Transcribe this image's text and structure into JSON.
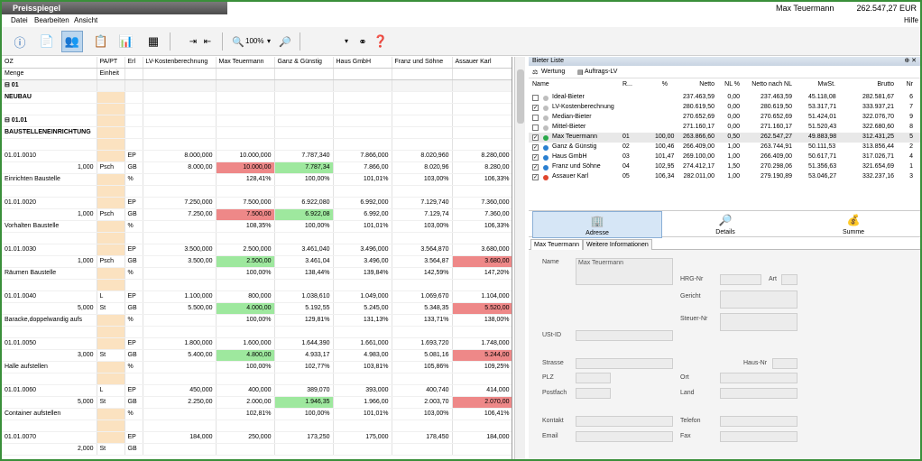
{
  "title": "Preisspiegel",
  "user": "Max Teuermann",
  "total": "262.547,27 EUR",
  "menu": {
    "datei": "Datei",
    "bearbeiten": "Bearbeiten",
    "ansicht": "Ansicht",
    "hilfe": "Hilfe"
  },
  "toolbar": {
    "zoom": "100%"
  },
  "grid": {
    "headers": [
      "OZ",
      "PA/PT",
      "Erl",
      "LV-Kostenberechnung",
      "Max Teuermann",
      "Ganz & Günstig",
      "Haus GmbH",
      "Franz und Söhne",
      "Assauer Karl"
    ],
    "subheaders": [
      "Menge",
      "Einheit"
    ],
    "rows": [
      {
        "c": [
          "⊟ 01",
          "",
          "",
          "",
          "",
          "",
          "",
          "",
          ""
        ],
        "t": "sec"
      },
      {
        "c": [
          "NEUBAU",
          "",
          "",
          "",
          "",
          "",
          "",
          "",
          ""
        ],
        "t": "bold"
      },
      {
        "c": [
          "",
          "",
          "",
          "",
          "",
          "",
          "",
          "",
          ""
        ]
      },
      {
        "c": [
          "⊟ 01.01",
          "",
          "",
          "",
          "",
          "",
          "",
          "",
          ""
        ],
        "t": "bold"
      },
      {
        "c": [
          "BAUSTELLENEINRICHTUNG",
          "",
          "",
          "",
          "",
          "",
          "",
          "",
          ""
        ],
        "t": "bold"
      },
      {
        "c": [
          "",
          "",
          "",
          "",
          "",
          "",
          "",
          "",
          ""
        ]
      },
      {
        "c": [
          "01.01.0010",
          "",
          "EP",
          "8.000,000",
          "10.000,000",
          "7.787,340",
          "7.866,000",
          "8.020,960",
          "8.280,000"
        ]
      },
      {
        "c": [
          "1,000",
          "Psch",
          "GB",
          "8.000,00",
          "10.000,00",
          "7.787,34",
          "7.866,00",
          "8.020,96",
          "8.280,00"
        ],
        "h": {
          "4": "red",
          "5": "green"
        }
      },
      {
        "c": [
          "Einrichten Baustelle",
          "",
          "%",
          "",
          "128,41%",
          "100,00%",
          "101,01%",
          "103,00%",
          "106,33%"
        ]
      },
      {
        "c": [
          "",
          "",
          "",
          "",
          "",
          "",
          "",
          "",
          ""
        ]
      },
      {
        "c": [
          "01.01.0020",
          "",
          "EP",
          "7.250,000",
          "7.500,000",
          "6.922,080",
          "6.992,000",
          "7.129,740",
          "7.360,000"
        ]
      },
      {
        "c": [
          "1,000",
          "Psch",
          "GB",
          "7.250,00",
          "7.500,00",
          "6.922,08",
          "6.992,00",
          "7.129,74",
          "7.360,00"
        ],
        "h": {
          "4": "red",
          "5": "green"
        }
      },
      {
        "c": [
          "Vorhalten Baustelle",
          "",
          "%",
          "",
          "108,35%",
          "100,00%",
          "101,01%",
          "103,00%",
          "106,33%"
        ]
      },
      {
        "c": [
          "",
          "",
          "",
          "",
          "",
          "",
          "",
          "",
          ""
        ]
      },
      {
        "c": [
          "01.01.0030",
          "",
          "EP",
          "3.500,000",
          "2.500,000",
          "3.461,040",
          "3.496,000",
          "3.564,870",
          "3.680,000"
        ]
      },
      {
        "c": [
          "1,000",
          "Psch",
          "GB",
          "3.500,00",
          "2.500,00",
          "3.461,04",
          "3.496,00",
          "3.564,87",
          "3.680,00"
        ],
        "h": {
          "4": "green",
          "8": "red"
        }
      },
      {
        "c": [
          "Räumen Baustelle",
          "",
          "%",
          "",
          "100,00%",
          "138,44%",
          "139,84%",
          "142,59%",
          "147,20%"
        ]
      },
      {
        "c": [
          "",
          "",
          "",
          "",
          "",
          "",
          "",
          "",
          ""
        ]
      },
      {
        "c": [
          "01.01.0040",
          "L",
          "EP",
          "1.100,000",
          "800,000",
          "1.038,610",
          "1.049,000",
          "1.069,670",
          "1.104,000"
        ]
      },
      {
        "c": [
          "5,000",
          "St",
          "GB",
          "5.500,00",
          "4.000,00",
          "5.192,55",
          "5.245,00",
          "5.348,35",
          "5.520,00"
        ],
        "h": {
          "4": "green",
          "8": "red"
        }
      },
      {
        "c": [
          "Baracke,doppelwandig aufs",
          "",
          "%",
          "",
          "100,00%",
          "129,81%",
          "131,13%",
          "133,71%",
          "138,00%"
        ]
      },
      {
        "c": [
          "",
          "",
          "",
          "",
          "",
          "",
          "",
          "",
          ""
        ]
      },
      {
        "c": [
          "01.01.0050",
          "",
          "EP",
          "1.800,000",
          "1.600,000",
          "1.644,390",
          "1.661,000",
          "1.693,720",
          "1.748,000"
        ]
      },
      {
        "c": [
          "3,000",
          "St",
          "GB",
          "5.400,00",
          "4.800,00",
          "4.933,17",
          "4.983,00",
          "5.081,16",
          "5.244,00"
        ],
        "h": {
          "4": "green",
          "8": "red"
        }
      },
      {
        "c": [
          "Halle aufstellen",
          "",
          "%",
          "",
          "100,00%",
          "102,77%",
          "103,81%",
          "105,86%",
          "109,25%"
        ]
      },
      {
        "c": [
          "",
          "",
          "",
          "",
          "",
          "",
          "",
          "",
          ""
        ]
      },
      {
        "c": [
          "01.01.0060",
          "L",
          "EP",
          "450,000",
          "400,000",
          "389,070",
          "393,000",
          "400,740",
          "414,000"
        ]
      },
      {
        "c": [
          "5,000",
          "St",
          "GB",
          "2.250,00",
          "2.000,00",
          "1.946,35",
          "1.966,00",
          "2.003,70",
          "2.070,00"
        ],
        "h": {
          "5": "green",
          "8": "red"
        }
      },
      {
        "c": [
          "Container aufstellen",
          "",
          "%",
          "",
          "102,81%",
          "100,00%",
          "101,01%",
          "103,00%",
          "106,41%"
        ]
      },
      {
        "c": [
          "",
          "",
          "",
          "",
          "",
          "",
          "",
          "",
          ""
        ]
      },
      {
        "c": [
          "01.01.0070",
          "",
          "E",
          "EP",
          "184,000",
          "250,000",
          "173,250",
          "175,000",
          "178,450",
          "184,000"
        ],
        "skip": true
      },
      {
        "c": [
          "2,000",
          "St",
          "GB",
          "",
          "",
          "",
          "",
          "",
          ""
        ]
      }
    ]
  },
  "bieter": {
    "panel_title": "Bieter Liste",
    "tool_wertung": "Wertung",
    "tool_auftrags": "Auftrags-LV",
    "cols": [
      "Name",
      "R...",
      "%",
      "Netto",
      "NL %",
      "Netto nach NL",
      "MwSt.",
      "Brutto",
      "Nr"
    ],
    "rows": [
      {
        "check": "",
        "dot": "#bdbdbd",
        "name": "Ideal-Bieter",
        "r": "",
        "pct": "",
        "netto": "237.463,59",
        "nl": "0,00",
        "nnl": "237.463,59",
        "mwst": "45.118,08",
        "brutto": "282.581,67",
        "nr": "6"
      },
      {
        "check": "✓",
        "dot": "#bdbdbd",
        "name": "LV-Kostenberechnung",
        "r": "",
        "pct": "",
        "netto": "280.619,50",
        "nl": "0,00",
        "nnl": "280.619,50",
        "mwst": "53.317,71",
        "brutto": "333.937,21",
        "nr": "7"
      },
      {
        "check": "",
        "dot": "#bdbdbd",
        "name": "Median-Bieter",
        "r": "",
        "pct": "",
        "netto": "270.652,69",
        "nl": "0,00",
        "nnl": "270.652,69",
        "mwst": "51.424,01",
        "brutto": "322.076,70",
        "nr": "9"
      },
      {
        "check": "",
        "dot": "#bdbdbd",
        "name": "Mittel-Bieter",
        "r": "",
        "pct": "",
        "netto": "271.160,17",
        "nl": "0,00",
        "nnl": "271.160,17",
        "mwst": "51.520,43",
        "brutto": "322.680,60",
        "nr": "8"
      },
      {
        "check": "✓",
        "dot": "#2aa84a",
        "name": "Max Teuermann",
        "r": "01",
        "pct": "100,00",
        "netto": "263.866,60",
        "nl": "0,50",
        "nnl": "262.547,27",
        "mwst": "49.883,98",
        "brutto": "312.431,25",
        "nr": "5",
        "sel": true
      },
      {
        "check": "✓",
        "dot": "#2a7fd0",
        "name": "Ganz & Günstig",
        "r": "02",
        "pct": "100,46",
        "netto": "266.409,00",
        "nl": "1,00",
        "nnl": "263.744,91",
        "mwst": "50.111,53",
        "brutto": "313.856,44",
        "nr": "2"
      },
      {
        "check": "✓",
        "dot": "#2a7fd0",
        "name": "Haus GmbH",
        "r": "03",
        "pct": "101,47",
        "netto": "269.100,00",
        "nl": "1,00",
        "nnl": "266.409,00",
        "mwst": "50.617,71",
        "brutto": "317.026,71",
        "nr": "4"
      },
      {
        "check": "✓",
        "dot": "#2a7fd0",
        "name": "Franz und Söhne",
        "r": "04",
        "pct": "102,95",
        "netto": "274.412,17",
        "nl": "1,50",
        "nnl": "270.298,06",
        "mwst": "51.356,63",
        "brutto": "321.654,69",
        "nr": "1"
      },
      {
        "check": "✓",
        "dot": "#e0452c",
        "name": "Assauer Karl",
        "r": "05",
        "pct": "106,34",
        "netto": "282.011,00",
        "nl": "1,00",
        "nnl": "279.190,89",
        "mwst": "53.046,27",
        "brutto": "332.237,16",
        "nr": "3"
      }
    ]
  },
  "tabs": {
    "adresse": "Adresse",
    "details": "Details",
    "summe": "Summe"
  },
  "subtabs": {
    "main": "Max Teuermann",
    "more": "Weitere Informationen"
  },
  "form": {
    "name_label": "Name",
    "name_value": "Max Teuermann",
    "hrg_label": "HRG-Nr",
    "art_label": "Art",
    "gericht_label": "Gericht",
    "steuer_label": "Steuer-Nr",
    "ust_label": "USt-ID",
    "strasse_label": "Strasse",
    "hausnr_label": "Haus-Nr",
    "plz_label": "PLZ",
    "ort_label": "Ort",
    "postfach_label": "Postfach",
    "land_label": "Land",
    "kontakt_label": "Kontakt",
    "telefon_label": "Telefon",
    "email_label": "Email",
    "fax_label": "Fax"
  }
}
